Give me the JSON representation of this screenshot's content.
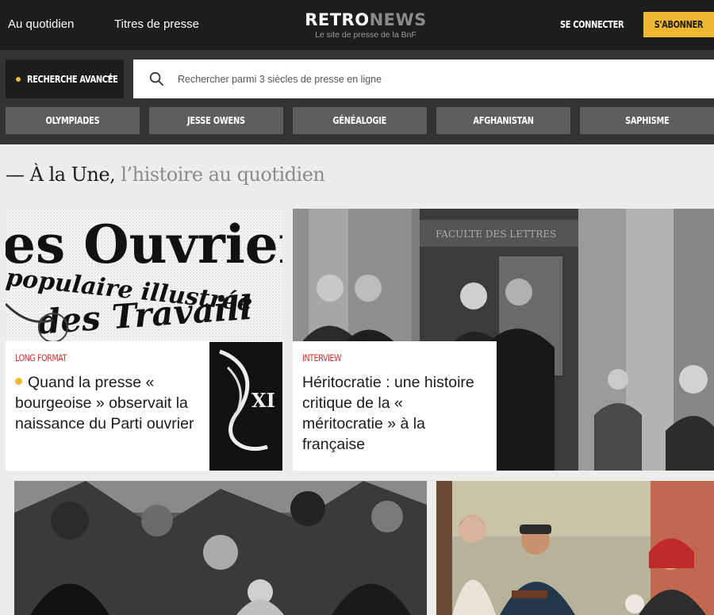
{
  "header": {
    "nav": [
      "Au quotidien",
      "Titres de presse"
    ],
    "logo_part1": "RETRO",
    "logo_part2": "NEWS",
    "logo_tagline": "Le site de presse de la BnF",
    "connect_label": "SE CONNECTER",
    "subscribe_label": "S'ABONNER"
  },
  "search": {
    "advanced_label": "RECHERCHE AVANCÉE",
    "advanced_plus": "+",
    "placeholder": "Rechercher parmi 3 siècles de presse en ligne"
  },
  "tags": [
    "OLYMPIADES",
    "JESSE OWENS",
    "GÉNÉALOGIE",
    "AFGHANISTAN",
    "SAPHISME"
  ],
  "section": {
    "title_main": "— À la Une,",
    "title_sub": " l’histoire au quotidien"
  },
  "cards": [
    {
      "kicker": "LONG FORMAT",
      "title": "Quand la presse « bourgeoise » observait la naissance du Parti ouvrier",
      "image_text_1": "es Ouvrier",
      "image_text_2": "populaire illustrée",
      "image_text_3": "des Travaill"
    },
    {
      "kicker": "INTERVIEW",
      "title": "Héritocratie : une histoire critique de la « méritocratie » à la française",
      "image_text_1": "FACULTE DES LETTRES"
    }
  ],
  "colors": {
    "header_bg": "#1d1d1d",
    "search_strip_bg": "#333333",
    "tag_bg": "#5e5e5e",
    "accent_yellow": "#f0b832",
    "kicker_red": "#c8302e"
  }
}
